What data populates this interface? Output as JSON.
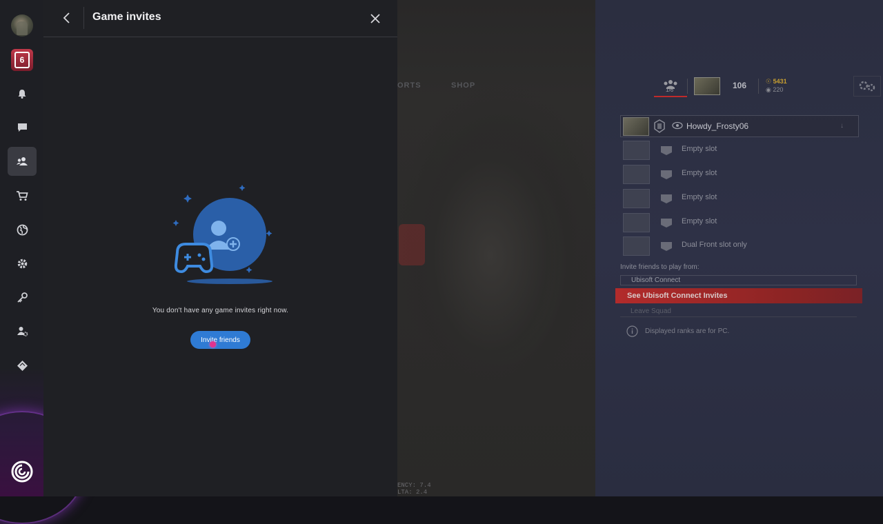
{
  "panel": {
    "title": "Game invites",
    "empty_message": "You don't have any game invites right now.",
    "invite_button": "Invite friends"
  },
  "sidebar": {
    "items": [
      {
        "name": "profile-avatar"
      },
      {
        "name": "rainbow-six-game-icon",
        "badge": "6"
      },
      {
        "name": "notifications",
        "icon": "bell-icon"
      },
      {
        "name": "chat",
        "icon": "chat-bubble-icon"
      },
      {
        "name": "friends",
        "icon": "friends-icon",
        "active": true
      },
      {
        "name": "store",
        "icon": "cart-icon"
      },
      {
        "name": "network",
        "icon": "globe-icon"
      },
      {
        "name": "settings",
        "icon": "gear-icon"
      },
      {
        "name": "keys",
        "icon": "key-icon"
      },
      {
        "name": "account-settings",
        "icon": "user-gear-icon"
      },
      {
        "name": "rewards",
        "icon": "badge-icon"
      }
    ]
  },
  "game": {
    "nav": {
      "item1": "ORTS",
      "item2": "SHOP"
    },
    "hud": {
      "squad_count": "1/6",
      "level": "106",
      "gold": "5431",
      "credits": "220"
    },
    "squad": {
      "leader": "Howdy_Frosty06",
      "slots": [
        "Empty slot",
        "Empty slot",
        "Empty slot",
        "Empty slot",
        "Dual Front slot only"
      ]
    },
    "invite_from_label": "Invite friends to play from:",
    "ubisoft_connect": "Ubisoft Connect",
    "see_invites": "See Ubisoft Connect Invites",
    "leave_squad": "Leave Squad",
    "ranks_note": "Displayed ranks are for PC.",
    "latency_line1": "ENCY: 7.4",
    "latency_line2": "LTA: 2.4"
  },
  "colors": {
    "accent_blue": "#2f7bd4",
    "illustration_blue": "#2a5fa8",
    "see_invites_red": "#b22b2b",
    "gold": "#c9a030"
  }
}
